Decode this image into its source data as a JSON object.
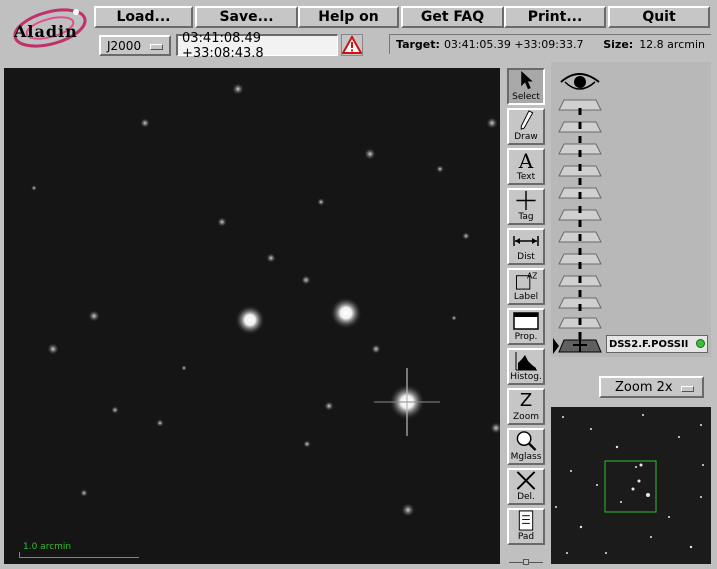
{
  "app": {
    "logo_text": "Aladin"
  },
  "menu": {
    "load": "Load...",
    "save": "Save...",
    "help": "Help on",
    "faq": "Get FAQ",
    "print": "Print...",
    "quit": "Quit"
  },
  "frame_select": {
    "value": "J2000"
  },
  "coord_input": {
    "value": "03:41:08.49 +33:08:43.8"
  },
  "info": {
    "target_label": "Target:",
    "target_value": "03:41:05.39 +33:09:33.7",
    "size_label": "Size:",
    "size_value": "12.8 arcmin"
  },
  "tools": [
    {
      "label": "Select",
      "icon": "arrow-cursor-icon"
    },
    {
      "label": "Draw",
      "icon": "pencil-icon"
    },
    {
      "label": "Text",
      "icon": "text-a-icon"
    },
    {
      "label": "Tag",
      "icon": "crosshair-icon"
    },
    {
      "label": "Dist",
      "icon": "distance-arrow-icon"
    },
    {
      "label": "Label",
      "icon": "label-az-icon"
    },
    {
      "label": "Prop.",
      "icon": "properties-window-icon"
    },
    {
      "label": "Histog.",
      "icon": "histogram-icon"
    },
    {
      "label": "Zoom",
      "icon": "zoom-z-icon"
    },
    {
      "label": "Mglass",
      "icon": "magnifier-icon"
    },
    {
      "label": "Del.",
      "icon": "delete-x-icon"
    },
    {
      "label": "Pad",
      "icon": "notepad-icon"
    }
  ],
  "layer": {
    "name": "DSS2.F.POSSII",
    "status_color": "#39c039"
  },
  "zoom": {
    "value": "Zoom 2x"
  },
  "scale": {
    "label": "1.0 arcmin"
  },
  "colors": {
    "scale_bar": "#2fbf2f",
    "thumb_box": "#2fbf2f"
  }
}
